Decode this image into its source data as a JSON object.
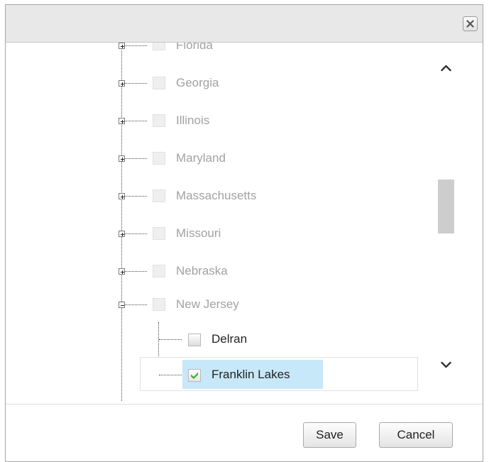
{
  "dialog": {
    "close_label": "Close",
    "save_label": "Save",
    "cancel_label": "Cancel"
  },
  "tree": {
    "states": [
      {
        "label": "Florida",
        "expanded": false
      },
      {
        "label": "Georgia",
        "expanded": false
      },
      {
        "label": "Illinois",
        "expanded": false
      },
      {
        "label": "Maryland",
        "expanded": false
      },
      {
        "label": "Massachusetts",
        "expanded": false
      },
      {
        "label": "Missouri",
        "expanded": false
      },
      {
        "label": "Nebraska",
        "expanded": false
      },
      {
        "label": "New Jersey",
        "expanded": true
      }
    ],
    "cities": [
      {
        "label": "Delran",
        "checked": false
      },
      {
        "label": "Franklin Lakes",
        "checked": true,
        "selected": true
      }
    ]
  },
  "colors": {
    "selected_row": "#c7e8f8",
    "check_mark": "#3bb12f",
    "state_text": "#a2a2a2",
    "city_text": "#222222"
  },
  "icons": {
    "close": "close-x-icon",
    "expand": "plus-icon",
    "collapse": "minus-icon",
    "scroll_up": "chevron-up-icon",
    "scroll_down": "chevron-down-icon",
    "check": "checkmark-icon"
  }
}
